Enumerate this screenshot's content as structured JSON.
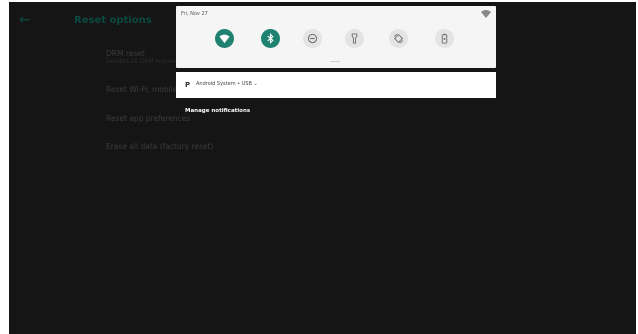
{
  "app_bar": {
    "title": "Reset options",
    "back_icon": "arrow-left-icon"
  },
  "settings": {
    "items": [
      {
        "title": "DRM reset",
        "subtitle": "Deletes all DRM licenses"
      },
      {
        "title": "Reset Wi-Fi, mobile & Bluetooth"
      },
      {
        "title": "Reset app preferences"
      },
      {
        "title": "Erase all data (factory reset)"
      }
    ]
  },
  "shade": {
    "date": "Fri, Nov 27",
    "tiles": [
      {
        "name": "wifi-icon",
        "state": "on"
      },
      {
        "name": "bluetooth-icon",
        "state": "on"
      },
      {
        "name": "do-not-disturb-icon",
        "state": "off"
      },
      {
        "name": "flashlight-icon",
        "state": "off"
      },
      {
        "name": "auto-rotate-icon",
        "state": "off"
      },
      {
        "name": "battery-saver-icon",
        "state": "off"
      }
    ]
  },
  "notification": {
    "icon": "P",
    "header": "Android System • USB ⌄"
  },
  "manage_notifications": "Manage notifications",
  "colors": {
    "accent": "#1f8271",
    "scrim": "#151515",
    "shade_bg": "#f5f5f5"
  }
}
